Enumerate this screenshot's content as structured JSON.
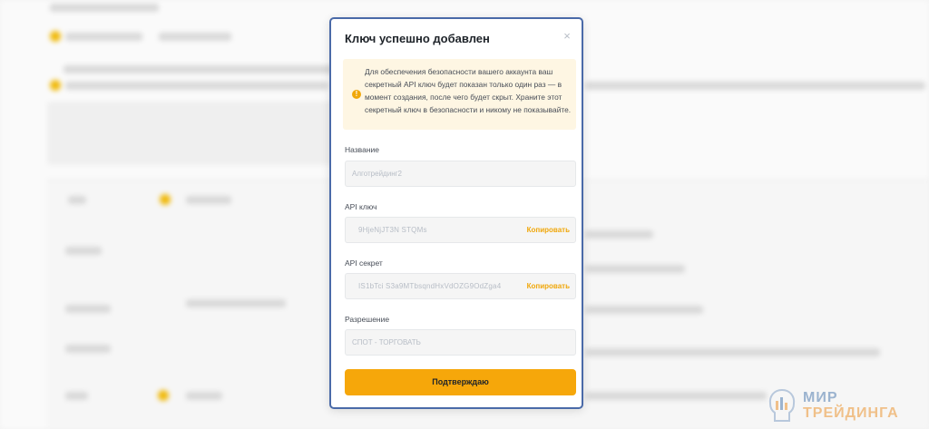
{
  "modal": {
    "title": "Ключ успешно добавлен",
    "close_glyph": "×",
    "warning_icon": "exclamation-circle-icon",
    "warning_text": "Для обеспечения безопасности вашего аккаунта ваш секретный API ключ будет показан только один раз — в момент создания, после чего будет скрыт. Храните этот секретный ключ в безопасности и никому не показывайте.",
    "fields": {
      "name": {
        "label": "Название",
        "value": "Алготрейдинг2"
      },
      "api_key": {
        "label": "API ключ",
        "value": "9HjeNjJT3N  STQMs",
        "copy_label": "Копировать"
      },
      "api_secret": {
        "label": "API секрет",
        "value": "IS1bTci   S3a9MTbsqndHxVdOZG9OdZga4",
        "copy_label": "Копировать"
      },
      "permission": {
        "label": "Разрешение",
        "value": "СПОТ - ТОРГОВАТЬ"
      }
    },
    "confirm_label": "Подтверждаю"
  },
  "watermark": {
    "line1": "МИР",
    "line2": "ТРЕЙДИНГА"
  },
  "colors": {
    "accent": "#f6a70a",
    "modal_border": "#4a6aa8",
    "warning_bg": "#fef6e3"
  }
}
